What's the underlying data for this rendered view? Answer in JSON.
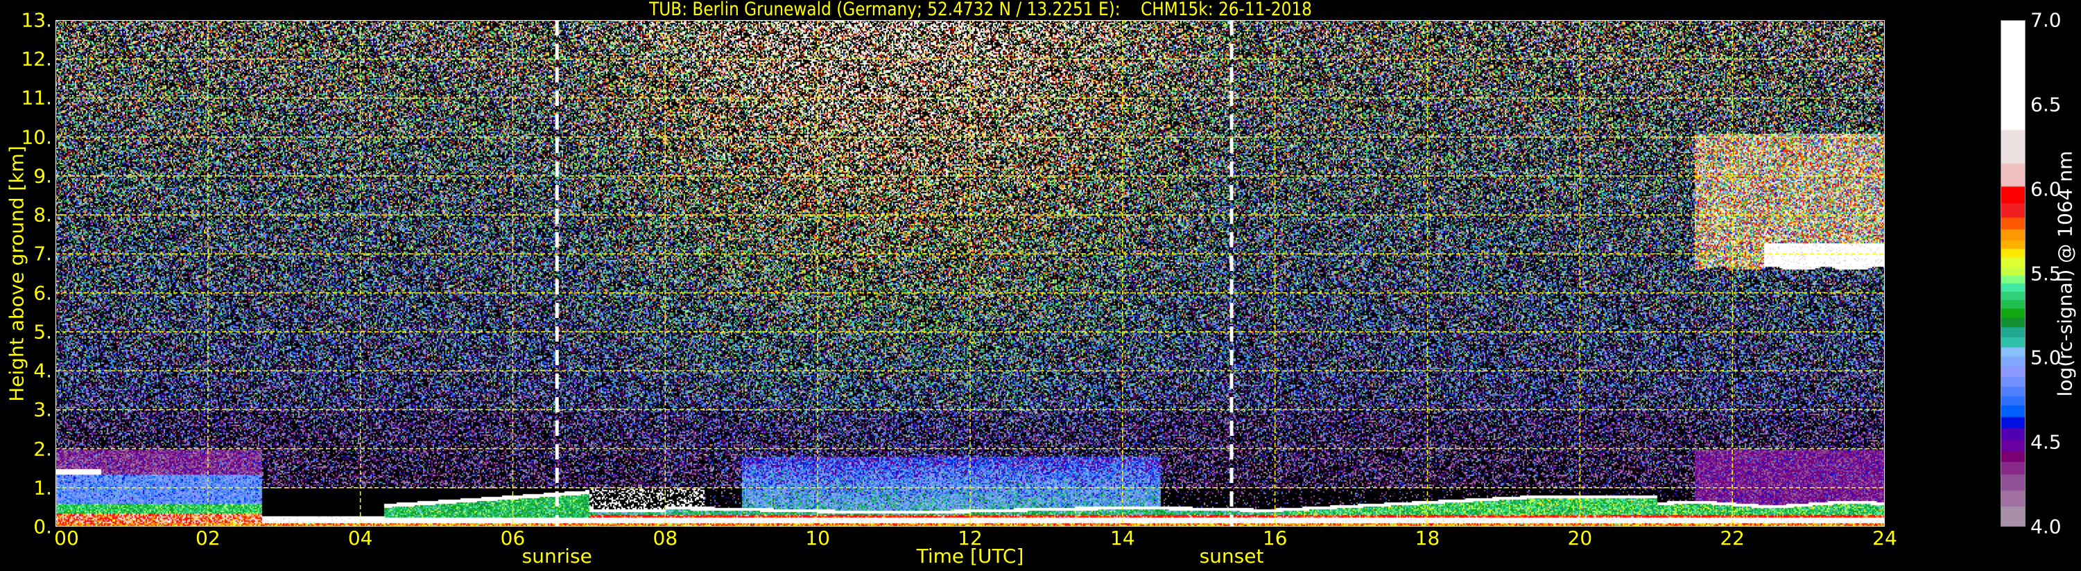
{
  "chart_data": {
    "type": "heatmap",
    "title": "TUB: Berlin Grunewald (Germany; 52.4732 N / 13.2251 E):    CHM15k: 26-11-2018",
    "xlabel": "Time [UTC]",
    "ylabel": "Height above ground [km]",
    "xlim": [
      0,
      24
    ],
    "ylim": [
      0,
      13
    ],
    "xticks": [
      "00",
      "02",
      "04",
      "06",
      "08",
      "10",
      "12",
      "14",
      "16",
      "18",
      "20",
      "22",
      "24"
    ],
    "yticks": [
      "0.",
      "1.",
      "2.",
      "3.",
      "4.",
      "5.",
      "6.",
      "7.",
      "8.",
      "9.",
      "10.",
      "11.",
      "12.",
      "13."
    ],
    "grid": true,
    "grid_color": "#ffff00",
    "annotations": [
      {
        "label": "sunrise",
        "time": 6.58
      },
      {
        "label": "sunset",
        "time": 15.43
      }
    ],
    "colorbar": {
      "label": "log(rc-signal) @ 1064 nm",
      "range": [
        4.0,
        7.0
      ],
      "ticks": [
        "4.0",
        "4.5",
        "5.0",
        "5.5",
        "6.0",
        "6.5",
        "7.0"
      ],
      "boundaries": [
        4.0,
        4.12,
        4.215,
        4.31,
        4.385,
        4.445,
        4.515,
        4.585,
        4.65,
        4.72,
        4.775,
        4.83,
        4.89,
        4.95,
        5.01,
        5.065,
        5.125,
        5.185,
        5.24,
        5.295,
        5.345,
        5.395,
        5.445,
        5.49,
        5.54,
        5.6,
        5.65,
        5.7,
        5.765,
        5.835,
        5.92,
        6.02,
        6.155,
        6.355,
        7.0
      ],
      "colors": [
        "#a890a8",
        "#9f70a0",
        "#905095",
        "#882888",
        "#780070",
        "#6a00a0",
        "#5000b0",
        "#0010e0",
        "#0060ff",
        "#3070ff",
        "#5080ff",
        "#7090ff",
        "#8c98ff",
        "#80a8ff",
        "#88c0ff",
        "#30c0a8",
        "#20a890",
        "#109030",
        "#10a810",
        "#20c050",
        "#30d078",
        "#40e8a0",
        "#80ff80",
        "#c8ff40",
        "#e0ff30",
        "#ffe800",
        "#ffb000",
        "#ff9800",
        "#ff5800",
        "#f02020",
        "#ff0000",
        "#f0c0c0",
        "#ede0e0",
        "#ffffff"
      ]
    },
    "features": [
      {
        "name": "surface layer",
        "time": [
          0,
          24
        ],
        "height_km": [
          0,
          0.15
        ],
        "value": 5.9
      },
      {
        "name": "night residual layer",
        "time": [
          0,
          2.7
        ],
        "height_km": [
          0.4,
          1.5
        ],
        "value": 4.9
      },
      {
        "name": "morning boundary layer",
        "time": [
          4.3,
          7
        ],
        "height_km": [
          0.2,
          0.9
        ],
        "value": 5.35
      },
      {
        "name": "daytime aerosol layer",
        "time": [
          9,
          14
        ],
        "height_km": [
          0.8,
          1.8
        ],
        "value": 5.0
      },
      {
        "name": "evening boundary layer",
        "time": [
          16,
          24
        ],
        "height_km": [
          0.15,
          0.8
        ],
        "value": 5.35
      },
      {
        "name": "cirrus cloud",
        "time": [
          21.5,
          24
        ],
        "height_km": [
          6.6,
          10.1
        ],
        "value": 6.3
      }
    ]
  }
}
